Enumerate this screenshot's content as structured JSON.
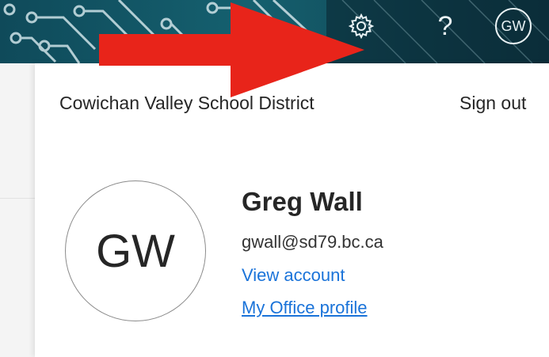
{
  "header": {
    "settings_icon": "gear-icon",
    "help_label": "?",
    "avatar_initials": "GW",
    "colors": {
      "banner": "#15606f",
      "annotation_arrow": "#e8241a"
    }
  },
  "account_panel": {
    "organization": "Cowichan Valley School District",
    "sign_out_label": "Sign out",
    "avatar_initials": "GW",
    "user_name": "Greg Wall",
    "email": "gwall@sd79.bc.ca",
    "view_account_label": "View account",
    "office_profile_label": "My Office profile",
    "link_color": "#1a73d9"
  }
}
